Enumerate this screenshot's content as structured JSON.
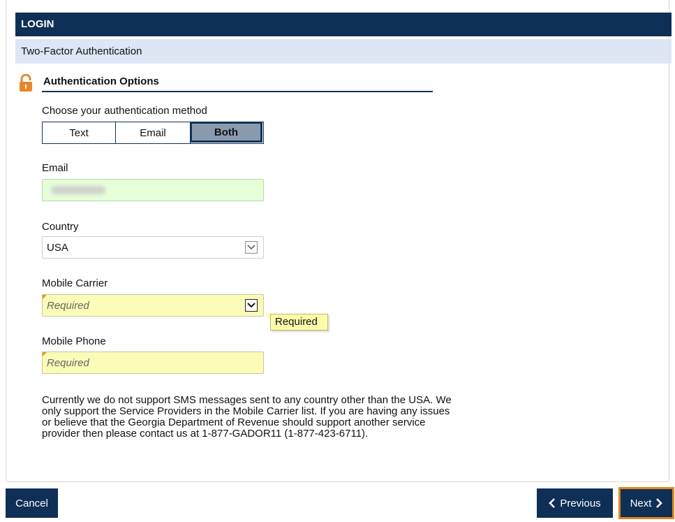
{
  "header": {
    "title": "LOGIN"
  },
  "subheader": {
    "title": "Two-Factor Authentication"
  },
  "section": {
    "title": "Authentication Options",
    "icon": "lock-icon"
  },
  "auth_method": {
    "label": "Choose your authentication method",
    "options": [
      "Text",
      "Email",
      "Both"
    ],
    "selected": "Both"
  },
  "email": {
    "label": "Email"
  },
  "country": {
    "label": "Country",
    "value": "USA"
  },
  "carrier": {
    "label": "Mobile Carrier",
    "placeholder": "Required",
    "tooltip": "Required"
  },
  "phone": {
    "label": "Mobile Phone",
    "placeholder": "Required"
  },
  "info": {
    "text": "Currently we do not support SMS messages sent to any country other than the USA. We only support the Service Providers in the Mobile Carrier list. If you are having any issues or believe that the Georgia Department of Revenue should support another service provider then please contact us at 1-877-GADOR11 (1-877-423-6711)."
  },
  "footer": {
    "cancel": "Cancel",
    "previous": "Previous",
    "next": "Next"
  },
  "colors": {
    "navy": "#0e2f56",
    "light_blue": "#dde6f5",
    "required_yellow": "#fbfbb8",
    "valid_green": "#e6ffd9",
    "focus_orange": "#e3861f"
  }
}
